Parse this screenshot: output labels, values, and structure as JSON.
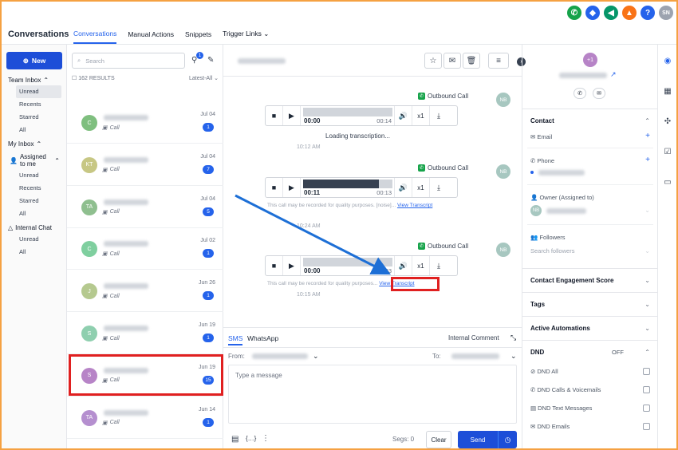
{
  "app_title": "Conversations",
  "tabs": [
    {
      "label": "Conversations"
    },
    {
      "label": "Manual Actions"
    },
    {
      "label": "Snippets"
    },
    {
      "label": "Trigger Links"
    }
  ],
  "topbar": {
    "avatar_initials": "SN"
  },
  "nav": {
    "new_label": "New",
    "team_inbox": "Team Inbox",
    "team_items": [
      "Unread",
      "Recents",
      "Starred",
      "All"
    ],
    "my_inbox": "My Inbox",
    "assigned_to_me": "Assigned to me",
    "assigned_items": [
      "Unread",
      "Recents",
      "Starred",
      "All"
    ],
    "internal_chat": "Internal Chat",
    "internal_items": [
      "Unread",
      "All"
    ]
  },
  "list": {
    "search_placeholder": "Search",
    "results_count": "162 RESULTS",
    "filter_label": "Latest-All",
    "filter_badge": "1",
    "rows": [
      {
        "initials": "C",
        "color": "#7fbf7f",
        "sub": "Call",
        "date": "Jul 04",
        "count": "1"
      },
      {
        "initials": "KT",
        "color": "#c7c784",
        "sub": "Call",
        "date": "Jul 04",
        "count": "7"
      },
      {
        "initials": "TA",
        "color": "#8fbf8f",
        "sub": "Call",
        "date": "Jul 04",
        "count": "5"
      },
      {
        "initials": "C",
        "color": "#7fcf9f",
        "sub": "Call",
        "date": "Jul 02",
        "count": "1"
      },
      {
        "initials": "J",
        "color": "#b5c98f",
        "sub": "Call",
        "date": "Jun 26",
        "count": "1"
      },
      {
        "initials": "S",
        "color": "#8fcfaf",
        "sub": "Call",
        "date": "Jun 19",
        "count": "1"
      },
      {
        "initials": "S",
        "color": "#b784c7",
        "sub": "Call",
        "date": "Jun 19",
        "count": "15"
      },
      {
        "initials": "TA",
        "color": "#b58fcf",
        "sub": "Call",
        "date": "Jun 14",
        "count": "1"
      }
    ]
  },
  "chat": {
    "messages": [
      {
        "label": "Outbound Call",
        "avatar": "NB",
        "time": "00:00",
        "duration": "00:14",
        "progress": 0.0,
        "speed": "x1",
        "status": "Loading transcription...",
        "timestamp": "10:12 AM"
      },
      {
        "label": "Outbound Call",
        "avatar": "NB",
        "time": "00:11",
        "duration": "00:13",
        "progress": 0.85,
        "speed": "x1",
        "disclaimer": "This call may be recorded for quality purposes. [noise]...",
        "link": "View Transcript",
        "timestamp": "10:24 AM"
      },
      {
        "label": "Outbound Call",
        "avatar": "NB",
        "time": "00:00",
        "duration": "00:03",
        "progress": 0.0,
        "speed": "x1",
        "disclaimer": "This call may be recorded for quality purposes...",
        "link": "View Transcript",
        "timestamp": "10:15 AM"
      }
    ],
    "composer": {
      "tab_sms": "SMS",
      "tab_whatsapp": "WhatsApp",
      "internal_comment": "Internal Comment",
      "from_label": "From:",
      "to_label": "To:",
      "placeholder": "Type a message",
      "segs": "Segs: 0",
      "clear": "Clear",
      "send": "Send"
    }
  },
  "right": {
    "avatar_initials": "+1",
    "contact": "Contact",
    "email": "Email",
    "phone": "Phone",
    "owner": "Owner (Assigned to)",
    "owner_initials": "NB",
    "followers": "Followers",
    "followers_placeholder": "Search followers",
    "engagement": "Contact Engagement Score",
    "tags": "Tags",
    "automations": "Active Automations",
    "dnd": "DND",
    "dnd_state": "OFF",
    "dnd_items": [
      "DND All",
      "DND Calls & Voicemails",
      "DND Text Messages",
      "DND Emails"
    ]
  },
  "colors": {
    "accent": "#2563eb",
    "highlight": "#e02020",
    "frame": "#f5a142"
  }
}
